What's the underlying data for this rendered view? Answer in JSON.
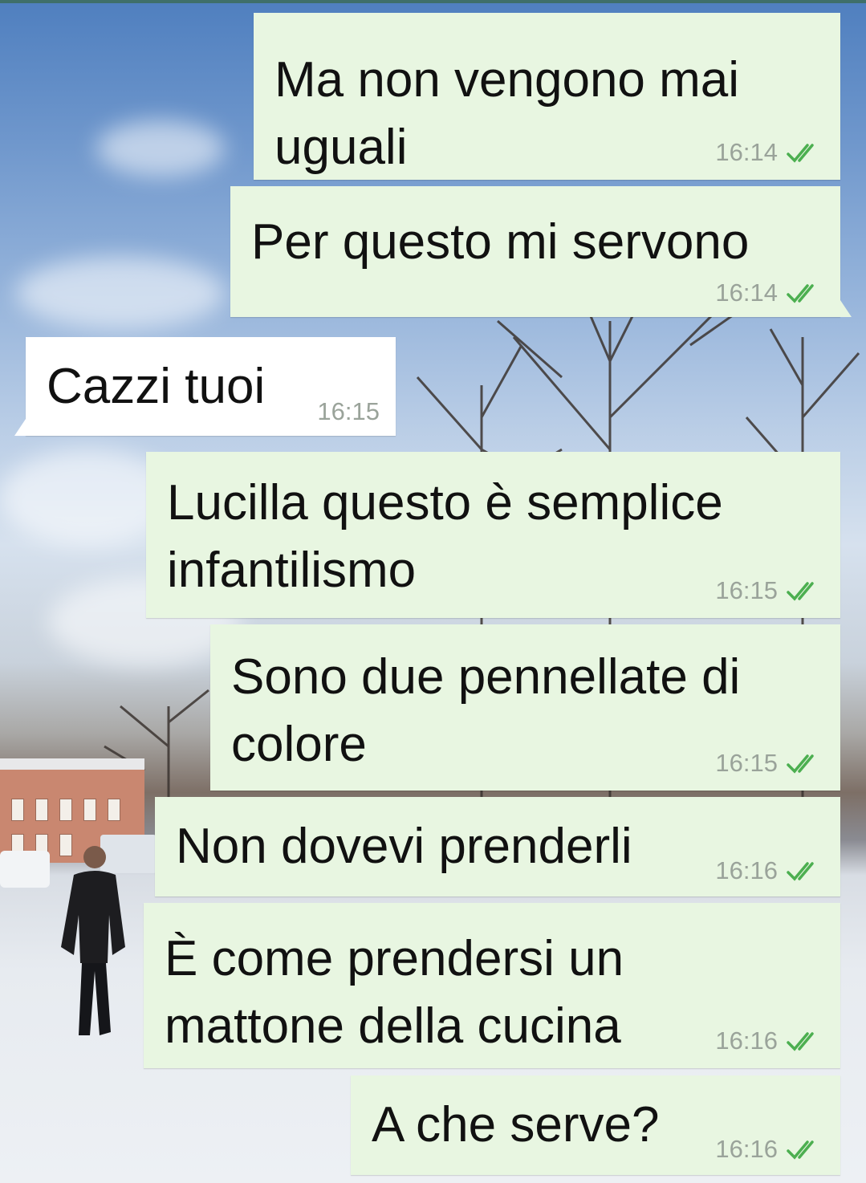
{
  "colors": {
    "outgoing_bubble": "#e8f6e1",
    "incoming_bubble": "#ffffff",
    "read_ticks": "#4caf50",
    "timestamp": "#9aa39a"
  },
  "messages": [
    {
      "direction": "outgoing",
      "text": "Ma non vengono mai\nuguali",
      "time": "16:14",
      "status": "read-double-check-icon"
    },
    {
      "direction": "outgoing",
      "text": "Per questo mi servono",
      "time": "16:14",
      "status": "read-double-check-icon"
    },
    {
      "direction": "incoming",
      "text": "Cazzi tuoi",
      "time": "16:15"
    },
    {
      "direction": "outgoing",
      "text": "Lucilla questo è semplice\ninfantilismo",
      "time": "16:15",
      "status": "read-double-check-icon"
    },
    {
      "direction": "outgoing",
      "text": "Sono due pennellate di\ncolore",
      "time": "16:15",
      "status": "read-double-check-icon"
    },
    {
      "direction": "outgoing",
      "text": "Non dovevi prenderli",
      "time": "16:16",
      "status": "read-double-check-icon"
    },
    {
      "direction": "outgoing",
      "text": "È come prendersi un\nmattone della cucina",
      "time": "16:16",
      "status": "read-double-check-icon"
    },
    {
      "direction": "outgoing",
      "text": "A che serve?",
      "time": "16:16",
      "status": "read-double-check-icon"
    }
  ]
}
